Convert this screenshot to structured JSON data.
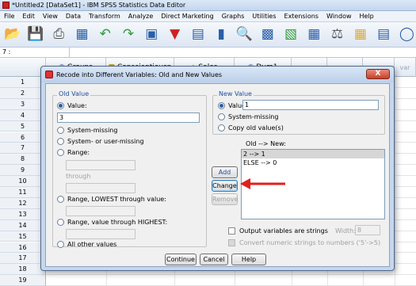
{
  "window": {
    "title": "*Untitled2 [DataSet1] - IBM SPSS Statistics Data Editor"
  },
  "menu": [
    "File",
    "Edit",
    "View",
    "Data",
    "Transform",
    "Analyze",
    "Direct Marketing",
    "Graphs",
    "Utilities",
    "Extensions",
    "Window",
    "Help"
  ],
  "toolbar": [
    "open-folder-icon",
    "save-icon",
    "print-icon",
    "dialog-recall-icon",
    "undo-icon",
    "redo-icon",
    "goto-case-icon",
    "goto-variable-icon",
    "variables-icon",
    "run-descriptive-icon",
    "find-icon",
    "insert-cases-icon",
    "insert-variable-icon",
    "split-file-icon",
    "weight-cases-icon",
    "select-cases-icon",
    "value-labels-icon",
    "use-sets-icon"
  ],
  "cell_reference": "7 :",
  "grid": {
    "columns": [
      "Groups",
      "Conscientiousn",
      "Sales",
      "Dum1",
      "var",
      "var",
      "var",
      "var"
    ],
    "rows": [
      "1",
      "2",
      "3",
      "4",
      "5",
      "6",
      "7",
      "8",
      "9",
      "10",
      "11",
      "12",
      "13",
      "14",
      "15",
      "16",
      "17",
      "18",
      "19"
    ]
  },
  "dialog": {
    "title": "Recode into Different Variables: Old and New Values",
    "close_label": "X",
    "old_value": {
      "group_label": "Old Value",
      "value_label": "Value:",
      "value_input": "3",
      "system_missing": "System-missing",
      "system_or_user_missing": "System- or user-missing",
      "range": "Range:",
      "through": "through",
      "range_lowest": "Range, LOWEST through value:",
      "range_highest": "Range, value through HIGHEST:",
      "all_other": "All other values"
    },
    "new_value": {
      "group_label": "New Value",
      "value_label": "Value:",
      "value_input": "1",
      "system_missing": "System-missing",
      "copy_old": "Copy old value(s)"
    },
    "old_new_label": "Old --> New:",
    "old_new_list": [
      "2 --> 1",
      "ELSE --> 0"
    ],
    "buttons": {
      "add": "Add",
      "change": "Change",
      "remove": "Remove",
      "continue": "Continue",
      "cancel": "Cancel",
      "help": "Help"
    },
    "output_strings": "Output variables are strings",
    "width_label": "Width:",
    "width_value": "8",
    "convert_numeric": "Convert numeric strings to numbers ('5'->5)"
  },
  "colors": {
    "accent": "#1f4e9e",
    "arrow": "#e0201e",
    "close": "#c8402a"
  }
}
